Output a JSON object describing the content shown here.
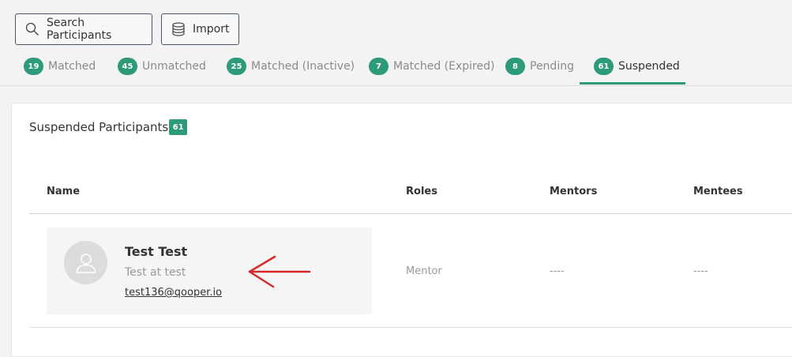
{
  "toolbar": {
    "search_label": "Search Participants",
    "search_icon": "search-icon",
    "import_label": "Import",
    "import_icon": "database-icon"
  },
  "tabs": [
    {
      "count": "19",
      "label": "Matched",
      "active": false
    },
    {
      "count": "45",
      "label": "Unmatched",
      "active": false
    },
    {
      "count": "25",
      "label": "Matched (Inactive)",
      "active": false
    },
    {
      "count": "7",
      "label": "Matched (Expired)",
      "active": false
    },
    {
      "count": "8",
      "label": "Pending",
      "active": false
    },
    {
      "count": "61",
      "label": "Suspended",
      "active": true
    }
  ],
  "panel": {
    "title": "Suspended Participants",
    "count": "61",
    "columns": {
      "name": "Name",
      "roles": "Roles",
      "mentors": "Mentors",
      "mentees": "Mentees"
    },
    "rows": [
      {
        "name": "Test Test",
        "subtitle": "Test at test",
        "email": "test136@qooper.io",
        "role": "Mentor",
        "mentors": "----",
        "mentees": "----"
      }
    ]
  },
  "colors": {
    "accent": "#2d9a7a",
    "annotation_arrow": "#d42a2a"
  }
}
